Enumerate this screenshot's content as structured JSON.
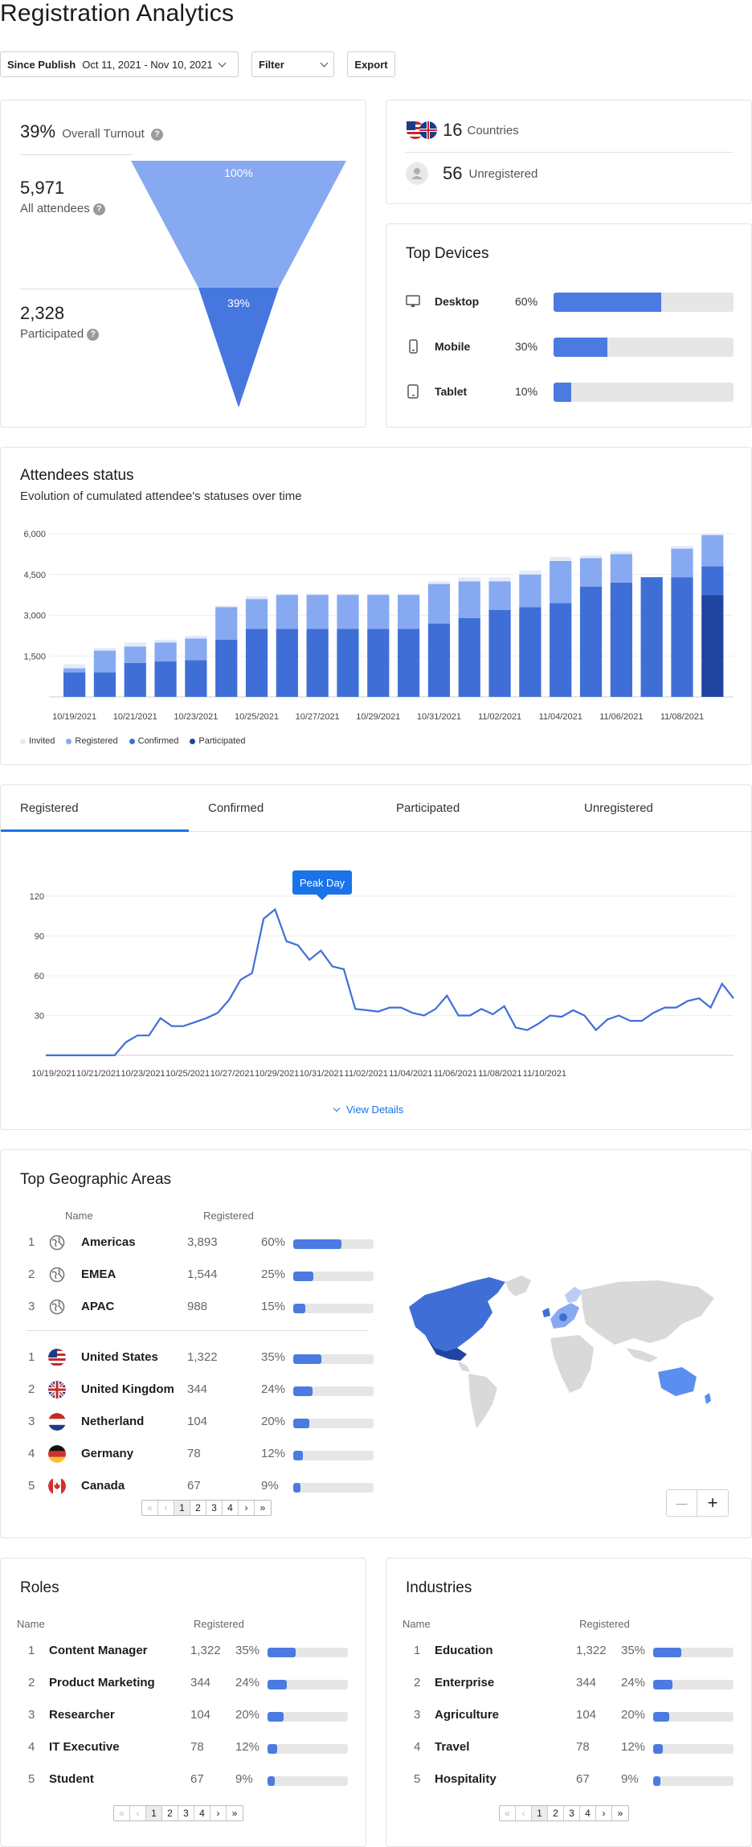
{
  "page": {
    "title": "Registration Analytics"
  },
  "toolbar": {
    "date_label": "Since Publish",
    "date_range": "Oct 11, 2021 - Nov 10, 2021",
    "filter_label": "Filter",
    "export_label": "Export"
  },
  "turnout": {
    "percent": "39%",
    "label": "Overall Turnout",
    "help": "?",
    "all_attendees_value": "5,971",
    "all_attendees_label": "All attendees",
    "participated_value": "2,328",
    "participated_label": "Participated",
    "funnel_top_pct": "100%",
    "funnel_bottom_pct": "39%"
  },
  "summary": {
    "countries_value": "16",
    "countries_label": "Countries",
    "unregistered_value": "56",
    "unregistered_label": "Unregistered"
  },
  "devices": {
    "title": "Top Devices",
    "items": [
      {
        "icon": "desktop-icon",
        "label": "Desktop",
        "pct": "60%",
        "fraction": 0.6
      },
      {
        "icon": "mobile-icon",
        "label": "Mobile",
        "pct": "30%",
        "fraction": 0.3
      },
      {
        "icon": "tablet-icon",
        "label": "Tablet",
        "pct": "10%",
        "fraction": 0.1
      }
    ]
  },
  "attendees_status": {
    "title": "Attendees status",
    "subtitle": "Evolution of cumulated attendee's statuses over time",
    "legend": [
      "Invited",
      "Registered",
      "Confirmed",
      "Participated"
    ]
  },
  "tabs": {
    "items": [
      "Registered",
      "Confirmed",
      "Participated",
      "Unregistered"
    ],
    "active": 0,
    "peak_label": "Peak Day",
    "view_details": "View Details"
  },
  "geo": {
    "title": "Top Geographic Areas",
    "col_name": "Name",
    "col_registered": "Registered",
    "regions": [
      {
        "rank": "1",
        "name": "Americas",
        "value": "3,893",
        "pct": "60%",
        "fraction": 0.6
      },
      {
        "rank": "2",
        "name": "EMEA",
        "value": "1,544",
        "pct": "25%",
        "fraction": 0.25
      },
      {
        "rank": "3",
        "name": "APAC",
        "value": "988",
        "pct": "15%",
        "fraction": 0.15
      }
    ],
    "countries": [
      {
        "rank": "1",
        "name": "United States",
        "value": "1,322",
        "pct": "35%",
        "fraction": 0.35,
        "flag": "us"
      },
      {
        "rank": "2",
        "name": "United Kingdom",
        "value": "344",
        "pct": "24%",
        "fraction": 0.24,
        "flag": "uk"
      },
      {
        "rank": "3",
        "name": "Netherland",
        "value": "104",
        "pct": "20%",
        "fraction": 0.2,
        "flag": "nl"
      },
      {
        "rank": "4",
        "name": "Germany",
        "value": "78",
        "pct": "12%",
        "fraction": 0.12,
        "flag": "de"
      },
      {
        "rank": "5",
        "name": "Canada",
        "value": "67",
        "pct": "9%",
        "fraction": 0.09,
        "flag": "ca"
      }
    ],
    "pager": [
      "«",
      "‹",
      "1",
      "2",
      "3",
      "4",
      "›",
      "»"
    ],
    "zoom_out": "—",
    "zoom_in": "+"
  },
  "roles": {
    "title": "Roles",
    "col_name": "Name",
    "col_registered": "Registered",
    "items": [
      {
        "rank": "1",
        "name": "Content Manager",
        "value": "1,322",
        "pct": "35%",
        "fraction": 0.35
      },
      {
        "rank": "2",
        "name": "Product Marketing",
        "value": "344",
        "pct": "24%",
        "fraction": 0.24
      },
      {
        "rank": "3",
        "name": "Researcher",
        "value": "104",
        "pct": "20%",
        "fraction": 0.2
      },
      {
        "rank": "4",
        "name": "IT Executive",
        "value": "78",
        "pct": "12%",
        "fraction": 0.12
      },
      {
        "rank": "5",
        "name": "Student",
        "value": "67",
        "pct": "9%",
        "fraction": 0.09
      }
    ],
    "pager": [
      "«",
      "‹",
      "1",
      "2",
      "3",
      "4",
      "›",
      "»"
    ]
  },
  "industries": {
    "title": "Industries",
    "col_name": "Name",
    "col_registered": "Registered",
    "items": [
      {
        "rank": "1",
        "name": "Education",
        "value": "1,322",
        "pct": "35%",
        "fraction": 0.35
      },
      {
        "rank": "2",
        "name": "Enterprise",
        "value": "344",
        "pct": "24%",
        "fraction": 0.24
      },
      {
        "rank": "3",
        "name": "Agriculture",
        "value": "104",
        "pct": "20%",
        "fraction": 0.2
      },
      {
        "rank": "4",
        "name": "Travel",
        "value": "78",
        "pct": "12%",
        "fraction": 0.12
      },
      {
        "rank": "5",
        "name": "Hospitality",
        "value": "67",
        "pct": "9%",
        "fraction": 0.09
      }
    ],
    "pager": [
      "«",
      "‹",
      "1",
      "2",
      "3",
      "4",
      "›",
      "»"
    ]
  },
  "colors": {
    "accent": "#1a73e8",
    "invited": "#e4ebf8",
    "registered": "#87a9f2",
    "confirmed": "#3f6fd6",
    "participated": "#1f45a0",
    "bar": "#4b7be0",
    "track": "#e6e6e6"
  },
  "chart_data": [
    {
      "type": "bar",
      "stacked": true,
      "ylim": [
        0,
        6000
      ],
      "yticks": [
        "1,500",
        "3,000",
        "4,500",
        "6,000"
      ],
      "ytick_values": [
        1500,
        3000,
        4500,
        6000
      ],
      "xtick_labels": [
        "10/19/2021",
        "10/21/2021",
        "10/23/2021",
        "10/25/2021",
        "10/27/2021",
        "10/29/2021",
        "10/31/2021",
        "11/02/2021",
        "11/04/2021",
        "11/06/2021",
        "11/08/2021"
      ],
      "categories": [
        "10/19",
        "10/20",
        "10/21",
        "10/22",
        "10/23",
        "10/24",
        "10/25",
        "10/26",
        "10/27",
        "10/28",
        "10/29",
        "10/30",
        "10/31",
        "11/01",
        "11/02",
        "11/03",
        "11/04",
        "11/05",
        "11/06",
        "11/07",
        "11/08",
        "11/09"
      ],
      "series": [
        {
          "name": "Participated",
          "values": [
            0,
            0,
            0,
            0,
            0,
            0,
            0,
            0,
            0,
            0,
            0,
            0,
            0,
            0,
            0,
            0,
            0,
            0,
            0,
            0,
            0,
            3750
          ]
        },
        {
          "name": "Confirmed",
          "values": [
            900,
            900,
            1250,
            1300,
            1350,
            2100,
            2500,
            2500,
            2500,
            2500,
            2500,
            2500,
            2700,
            2900,
            3200,
            3300,
            3450,
            4050,
            4200,
            4400,
            4400,
            1050
          ]
        },
        {
          "name": "Registered",
          "values": [
            150,
            800,
            600,
            700,
            800,
            1200,
            1100,
            1250,
            1250,
            1250,
            1250,
            1250,
            1450,
            1350,
            1050,
            1200,
            1550,
            1050,
            1050,
            0,
            1050,
            1150
          ]
        },
        {
          "name": "Invited",
          "values": [
            150,
            100,
            150,
            100,
            100,
            50,
            100,
            50,
            50,
            50,
            50,
            50,
            100,
            150,
            150,
            150,
            150,
            100,
            100,
            0,
            100,
            50
          ]
        }
      ]
    },
    {
      "type": "line",
      "ylim": [
        0,
        130
      ],
      "yticks": [
        30,
        60,
        90,
        120
      ],
      "xtick_labels": [
        "10/19/2021",
        "10/21/2021",
        "10/23/2021",
        "10/25/2021",
        "10/27/2021",
        "10/29/2021",
        "10/31/2021",
        "11/02/2021",
        "11/04/2021",
        "11/06/2021",
        "11/08/2021",
        "11/10/2021"
      ],
      "values": [
        0,
        0,
        0,
        0,
        0,
        0,
        0,
        10,
        15,
        15,
        28,
        22,
        22,
        25,
        28,
        32,
        42,
        57,
        62,
        103,
        110,
        86,
        83,
        72,
        79,
        67,
        65,
        35,
        34,
        33,
        36,
        36,
        32,
        30,
        35,
        45,
        30,
        30,
        35,
        31,
        37,
        21,
        19,
        24,
        30,
        29,
        34,
        30,
        19,
        27,
        30,
        26,
        26,
        32,
        36,
        36,
        41,
        43,
        36,
        54,
        43
      ]
    }
  ]
}
